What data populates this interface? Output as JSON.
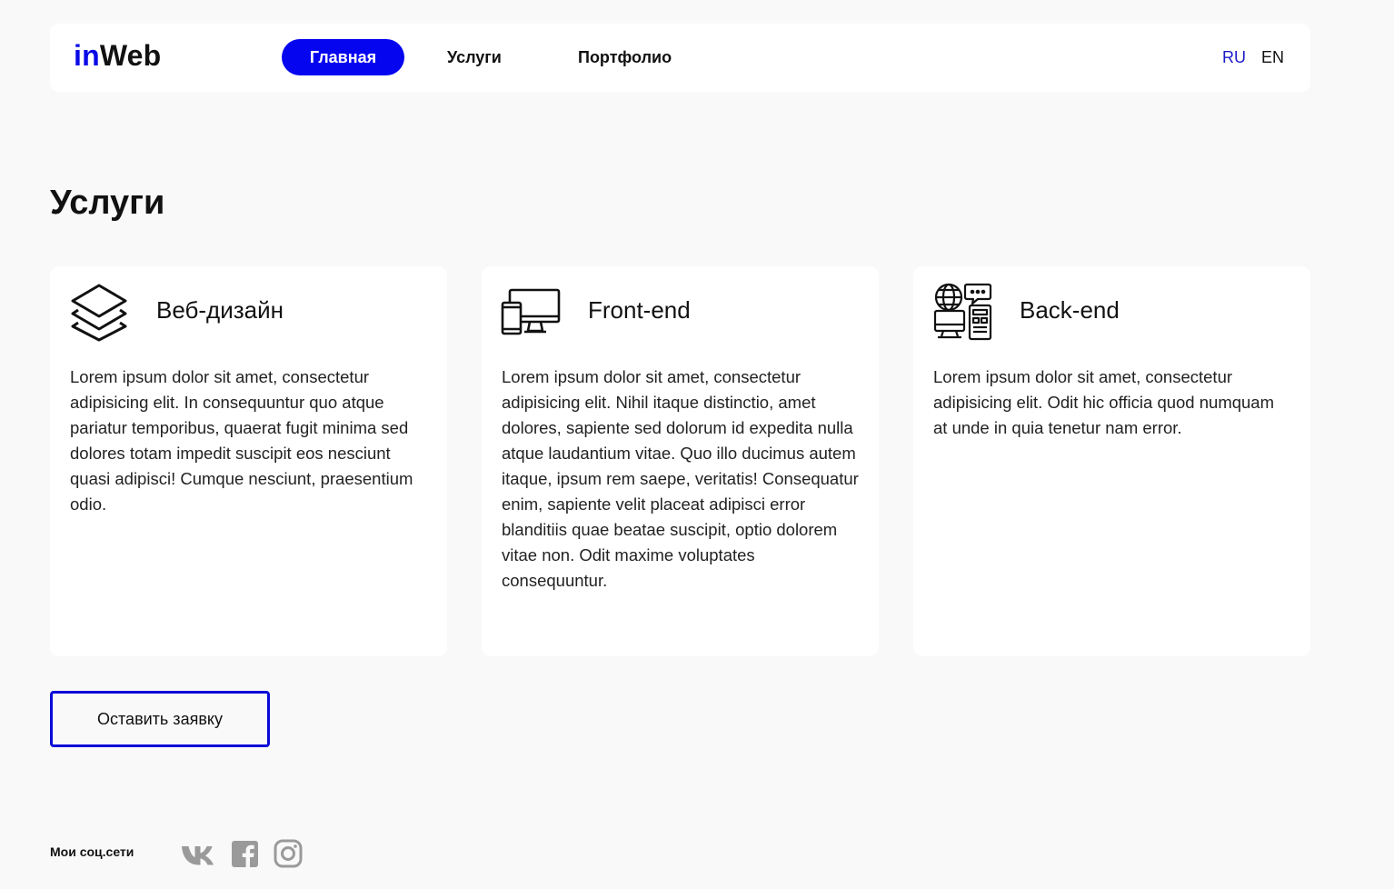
{
  "header": {
    "logo_accent": "in",
    "logo_rest": "Web",
    "nav": [
      {
        "label": "Главная"
      },
      {
        "label": "Услуги"
      },
      {
        "label": "Портфолио"
      }
    ],
    "languages": [
      "RU",
      "EN"
    ],
    "active_language": "RU"
  },
  "services": {
    "title": "Услуги",
    "cards": [
      {
        "icon": "layers-icon",
        "title": "Веб-дизайн",
        "text": "Lorem ipsum dolor sit amet, consectetur adipisicing elit. In consequuntur quo atque pariatur temporibus, quaerat fugit minima sed dolores totam impedit suscipit eos nesciunt quasi adipisci! Cumque nesciunt, praesentium odio."
      },
      {
        "icon": "devices-icon",
        "title": "Front-end",
        "text": "Lorem ipsum dolor sit amet, consectetur adipisicing elit. Nihil itaque distinctio, amet dolores, sapiente sed dolorum id expedita nulla atque laudantium vitae. Quo illo ducimus autem itaque, ipsum rem saepe, veritatis! Consequatur enim, sapiente velit placeat adipisci error blanditiis quae beatae suscipit, optio dolorem vitae non. Odit maxime voluptates consequuntur."
      },
      {
        "icon": "server-network-icon",
        "title": "Back-end",
        "text": "Lorem ipsum dolor sit amet, consectetur adipisicing elit. Odit hic officia quod numquam at unde in quia tenetur nam error."
      }
    ],
    "cta_label": "Оставить заявку"
  },
  "footer": {
    "social_label": "Мои соц.сети",
    "social_icons": [
      "vk-icon",
      "facebook-icon",
      "instagram-icon"
    ]
  },
  "colors": {
    "accent": "#0505f0",
    "background": "#f9f9f9",
    "card": "#ffffff"
  }
}
